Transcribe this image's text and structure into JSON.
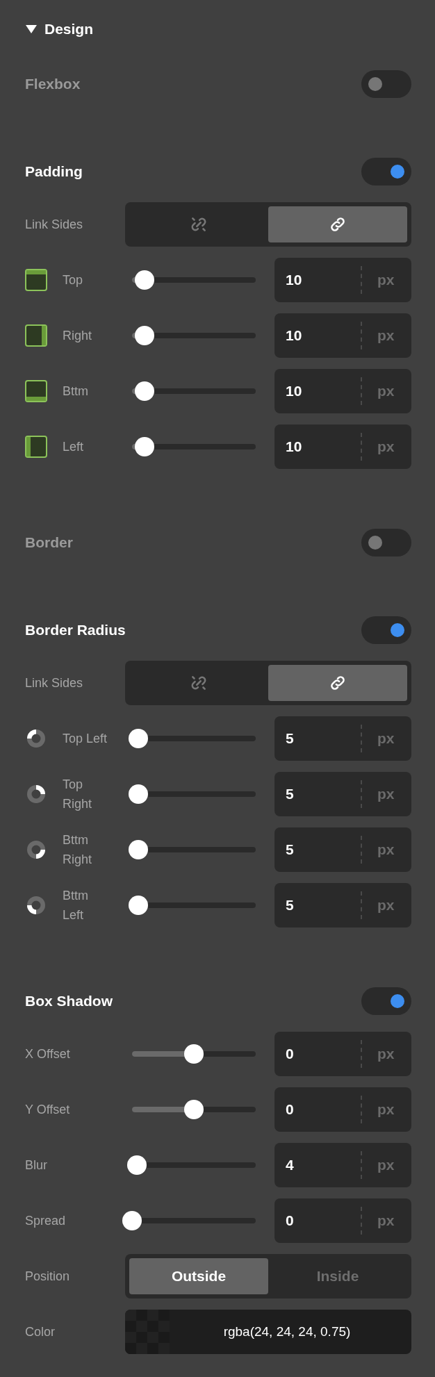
{
  "panel": {
    "title": "Design",
    "expanded": true
  },
  "sections": [
    {
      "title": "Flexbox",
      "enabled": false
    },
    {
      "title": "Padding",
      "kind": "sides",
      "enabled": true,
      "rows": [
        {
          "kind": "link",
          "label": "Link Sides",
          "options": [
            {
              "kind": "unlink",
              "selected": false
            },
            {
              "kind": "link",
              "selected": true
            }
          ]
        },
        {
          "kind": "slider",
          "label": "Top",
          "level": 0.1,
          "value": "10",
          "unit": "px"
        },
        {
          "kind": "slider",
          "label": "Right",
          "level": 0.1,
          "value": "10",
          "unit": "px"
        },
        {
          "kind": "slider",
          "label": "Bttm",
          "level": 0.1,
          "value": "10",
          "unit": "px"
        },
        {
          "kind": "slider",
          "label": "Left",
          "level": 0.1,
          "value": "10",
          "unit": "px"
        }
      ]
    },
    {
      "title": "Border",
      "enabled": false
    },
    {
      "title": "Border Radius",
      "kind": "corners",
      "enabled": true,
      "rows": [
        {
          "kind": "link",
          "label": "Link Sides",
          "options": [
            {
              "kind": "unlink",
              "selected": false
            },
            {
              "kind": "link",
              "selected": true
            }
          ]
        },
        {
          "kind": "slider",
          "label": "Top Left",
          "level": 0.05,
          "value": "5",
          "unit": "px"
        },
        {
          "kind": "slider",
          "label": "Top Right",
          "level": 0.05,
          "value": "5",
          "unit": "px"
        },
        {
          "kind": "slider",
          "label": "Bttm Right",
          "level": 0.05,
          "value": "5",
          "unit": "px"
        },
        {
          "kind": "slider",
          "label": "Bttm Left",
          "level": 0.05,
          "value": "5",
          "unit": "px"
        }
      ]
    },
    {
      "title": "Box Shadow",
      "kind": "plain",
      "enabled": true,
      "rows": [
        {
          "kind": "slider",
          "label": "X Offset",
          "level": 0.5,
          "value": "0",
          "unit": "px"
        },
        {
          "kind": "slider",
          "label": "Y Offset",
          "level": 0.5,
          "value": "0",
          "unit": "px"
        },
        {
          "kind": "slider",
          "label": "Blur",
          "level": 0.04,
          "value": "4",
          "unit": "px"
        },
        {
          "kind": "slider",
          "label": "Spread",
          "level": 0,
          "value": "0",
          "unit": "px"
        },
        {
          "kind": "segmented",
          "label": "Position",
          "options": [
            {
              "label": "Outside",
              "selected": true
            },
            {
              "label": "Inside",
              "selected": false
            }
          ]
        },
        {
          "kind": "color",
          "label": "Color",
          "value": "rgba(24, 24, 24, 0.75)"
        }
      ]
    }
  ]
}
